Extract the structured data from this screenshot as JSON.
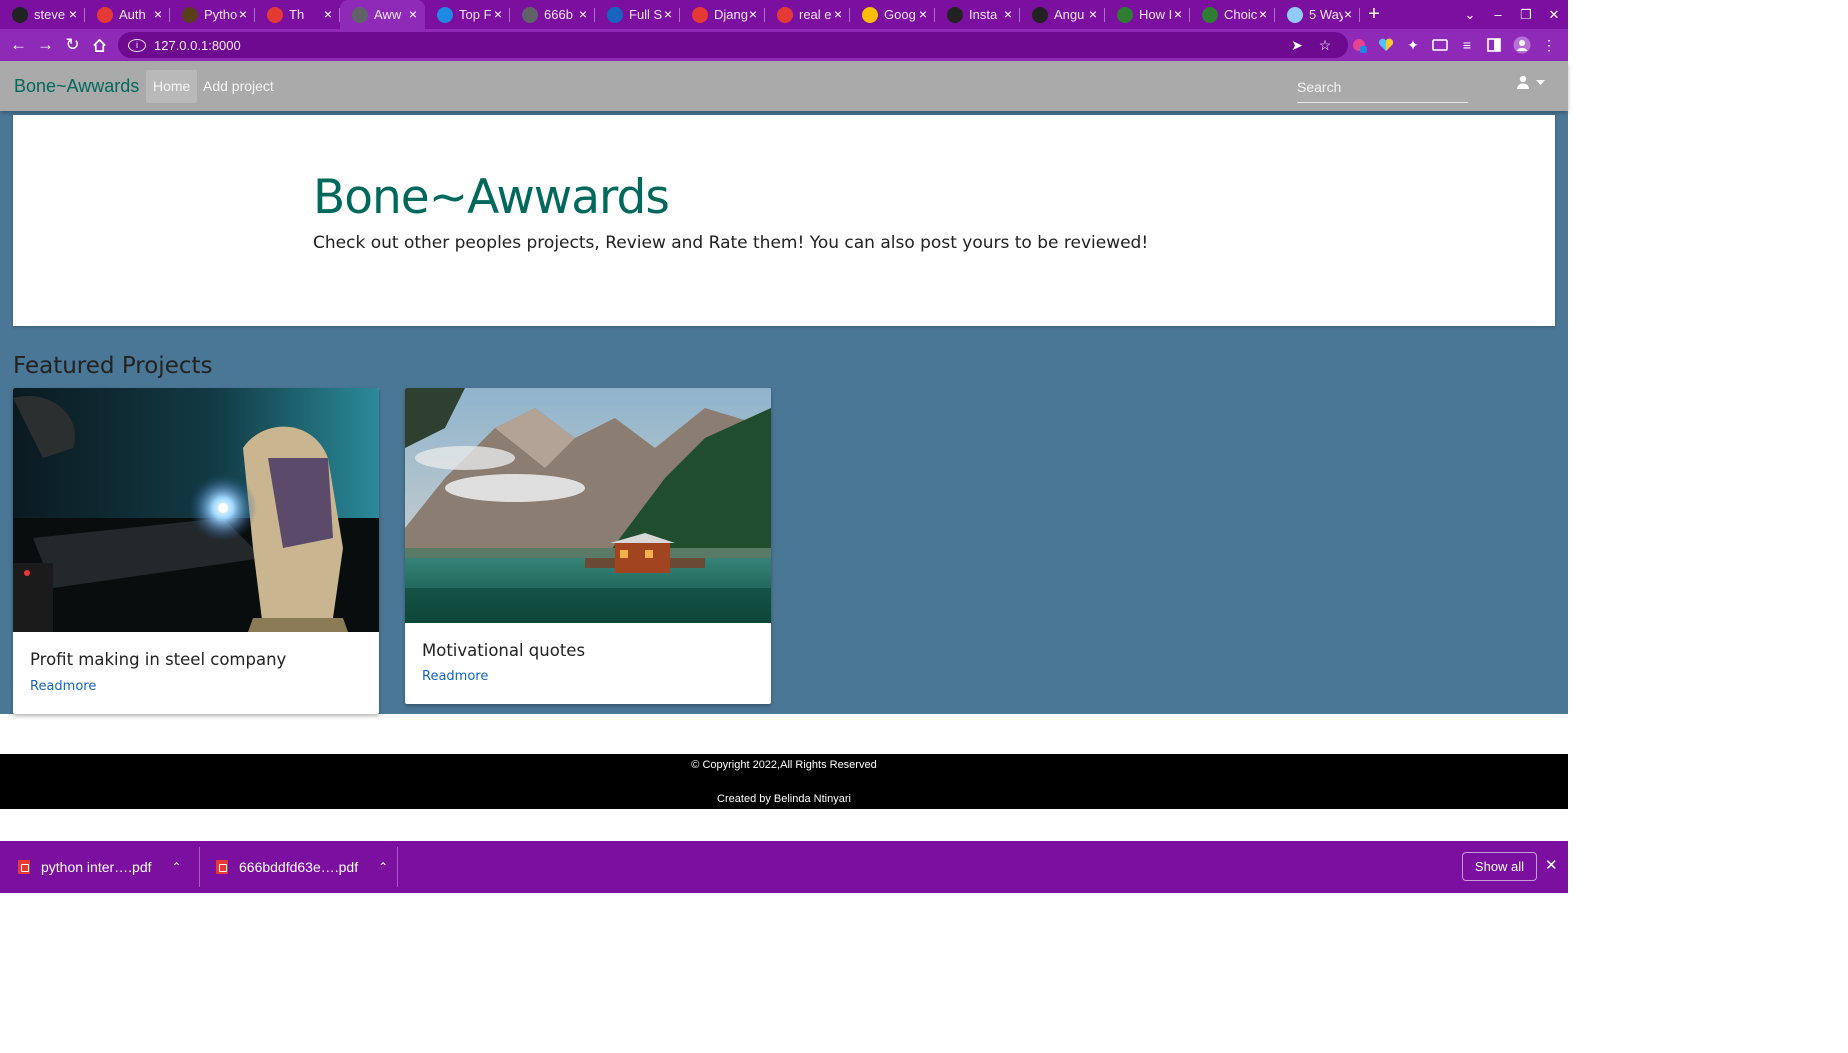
{
  "browser": {
    "tabs": [
      {
        "title": "steve",
        "favicon_color": "#222222",
        "favicon": "github-icon"
      },
      {
        "title": "Auth",
        "favicon_color": "#e53935",
        "favicon": "youtube-icon"
      },
      {
        "title": "Pytho",
        "favicon_color": "#5a3e1b",
        "favicon": "python-icon"
      },
      {
        "title": "Th",
        "favicon_color": "#e53935",
        "favicon": "youtube-icon"
      },
      {
        "title": "Aww",
        "favicon_color": "#5f6368",
        "favicon": "globe-icon"
      },
      {
        "title": "Top F",
        "favicon_color": "#1e88e5",
        "favicon": "mountain-icon"
      },
      {
        "title": "666b",
        "favicon_color": "#5f6368",
        "favicon": "globe-icon"
      },
      {
        "title": "Full S",
        "favicon_color": "#1565c0",
        "favicon": "bookmark-icon"
      },
      {
        "title": "Djang",
        "favicon_color": "#e53935",
        "favicon": "youtube-icon"
      },
      {
        "title": "real e",
        "favicon_color": "#e53935",
        "favicon": "youtube-icon"
      },
      {
        "title": "Goog",
        "favicon_color": "#fbbc05",
        "favicon": "google-drive-icon"
      },
      {
        "title": "Insta",
        "favicon_color": "#222222",
        "favicon": "github-icon"
      },
      {
        "title": "Angu",
        "favicon_color": "#222222",
        "favicon": "app-icon"
      },
      {
        "title": "How I",
        "favicon_color": "#2e7d32",
        "favicon": "link-icon"
      },
      {
        "title": "Choic",
        "favicon_color": "#2e7d32",
        "favicon": "link-icon"
      },
      {
        "title": "5 Way",
        "favicon_color": "#90caf9",
        "favicon": "loading-icon"
      }
    ],
    "active_tab": 4,
    "url": "127.0.0.1:8000"
  },
  "navbar": {
    "brand": "Bone~Awwards",
    "links": [
      "Home",
      "Add project"
    ],
    "search_placeholder": "Search"
  },
  "hero": {
    "title": "Bone~Awwards",
    "subtitle": "Check out other peoples projects, Review and Rate them! You can also post yours to be reviewed!"
  },
  "featured": {
    "heading": "Featured Projects",
    "projects": [
      {
        "title": "Profit making in steel company",
        "link": "Readmore",
        "image": "welder-photo"
      },
      {
        "title": "Motivational quotes",
        "link": "Readmore",
        "image": "mountain-lake-photo"
      }
    ]
  },
  "footer": {
    "copyright": "© Copyright 2022,All Rights Reserved",
    "credit": "Created by Belinda Ntinyari"
  },
  "downloads": {
    "items": [
      "python inter….pdf",
      "666bddfd63e….pdf"
    ],
    "show_all": "Show all"
  },
  "colors": {
    "browser_frame": "#7b0fa0",
    "brand": "#00695c",
    "navbar": "#aaaaaa",
    "page_bg": "#4b7796",
    "link": "#1565c0"
  }
}
